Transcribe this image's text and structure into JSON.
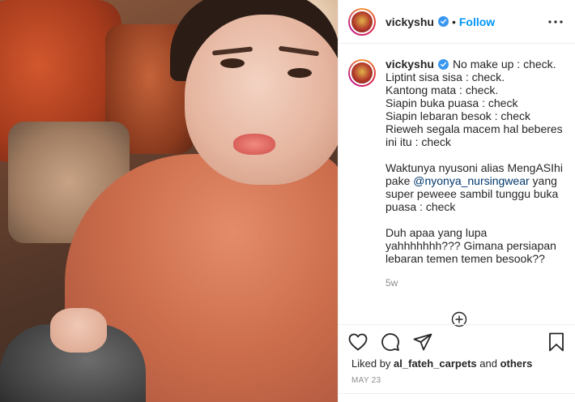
{
  "post": {
    "username": "vickyshu",
    "follow_label": "Follow",
    "separator": "•",
    "caption": {
      "first_line": "No make up : check.",
      "lines": [
        "Liptint sisa sisa : check.",
        "Kantong mata : check.",
        "Siapin buka puasa : check",
        "Siapin lebaran besok : check",
        "Rieweh segala macem hal beberes ini itu : check"
      ],
      "paragraph2_before": "Waktunya nyusoni alias MengASIhi pake ",
      "mention": "@nyonya_nursingwear",
      "paragraph2_after": " yang super peweee sambil tunggu buka puasa : check",
      "paragraph3": "Duh apaa yang lupa yahhhhhhh??? Gimana persiapan lebaran temen temen besook??"
    },
    "relative_time": "5w",
    "likes": {
      "prefix": "Liked by ",
      "user": "al_fateh_carpets",
      "middle": " and ",
      "others": "others"
    },
    "date": "MAY 23"
  },
  "icons": {
    "verified": "verified-badge-icon",
    "more": "more-options-icon",
    "load_more": "load-more-comments-icon",
    "like": "heart-icon",
    "comment": "comment-icon",
    "share": "share-icon",
    "save": "bookmark-icon"
  },
  "colors": {
    "link_blue": "#0095f6",
    "verified_blue": "#3897f0",
    "mention": "#00376b",
    "secondary_text": "#8e8e8e"
  }
}
